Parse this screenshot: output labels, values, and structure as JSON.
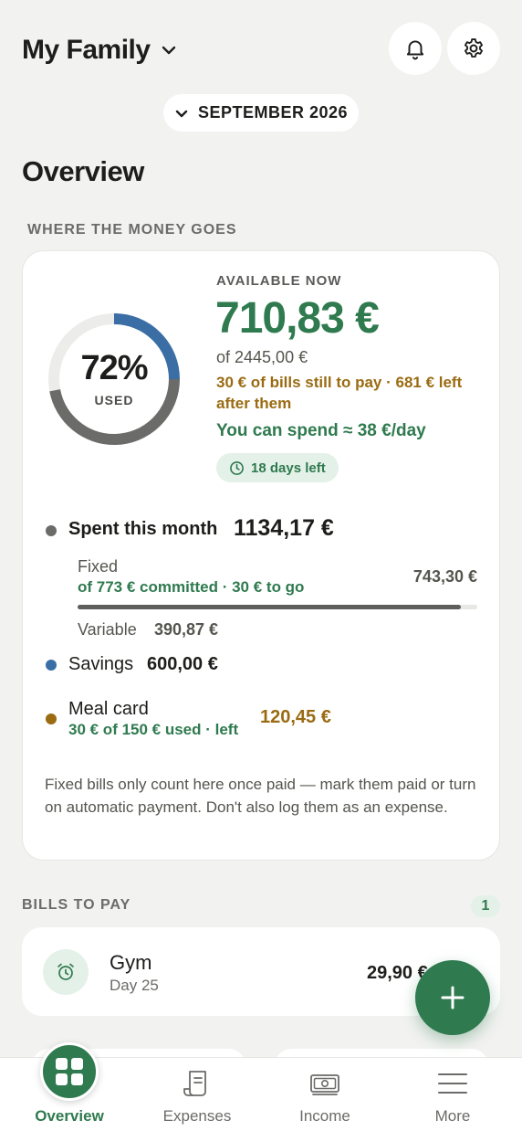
{
  "header": {
    "family_name": "My Family",
    "family_icon": "chevron-down-icon",
    "notifications_icon": "bell-icon",
    "settings_icon": "gear-icon"
  },
  "month_selector": {
    "label": "SEPTEMBER 2026",
    "icon": "chevron-down-icon"
  },
  "page_title": "Overview",
  "money_section": {
    "label": "WHERE THE MONEY GOES",
    "donut": {
      "percent_label": "72%",
      "used_label": "USED",
      "used_fraction": 0.72,
      "savings_fraction": 0.25,
      "spent_color": "#6b6b69",
      "savings_color": "#3a6ea5",
      "track_color": "#ececea"
    },
    "available_label": "AVAILABLE NOW",
    "available_amount": "710,83 €",
    "of_total": "of 2445,00 €",
    "bills_left_text": "30 € of bills still to pay · 681 € left after them",
    "per_day_text": "You can spend ≈ 38 €/day",
    "days_left": "18 days left",
    "spent": {
      "label": "Spent this month",
      "value": "1134,17 €",
      "dot_color": "#6b6b69"
    },
    "fixed": {
      "label": "Fixed",
      "sub": "of 773 € committed · 30 € to go",
      "value": "743,30 €",
      "progress": 0.96
    },
    "variable": {
      "label": "Variable",
      "value": "390,87 €"
    },
    "savings": {
      "label": "Savings",
      "value": "600,00 €",
      "dot_color": "#3a6ea5"
    },
    "meal_card": {
      "label": "Meal card",
      "sub": "30 € of 150 € used · left",
      "value": "120,45 €",
      "dot_color": "#9a6b12"
    },
    "note": "Fixed bills only count here once paid — mark them paid or turn on automatic payment. Don't also log them as an expense."
  },
  "bills_section": {
    "label": "BILLS TO PAY",
    "count": "1",
    "items": [
      {
        "name": "Gym",
        "day": "Day 25",
        "amount": "29,90 €",
        "icon": "alarm-clock-icon"
      }
    ]
  },
  "fab": {
    "icon": "plus-icon"
  },
  "bottom_nav": [
    {
      "label": "Overview",
      "icon": "grid-icon",
      "active": true
    },
    {
      "label": "Expenses",
      "icon": "receipt-icon",
      "active": false
    },
    {
      "label": "Income",
      "icon": "banknote-icon",
      "active": false
    },
    {
      "label": "More",
      "icon": "menu-icon",
      "active": false
    }
  ],
  "colors": {
    "accent": "#2f7a4f",
    "warning": "#9a6b12",
    "savings": "#3a6ea5"
  }
}
